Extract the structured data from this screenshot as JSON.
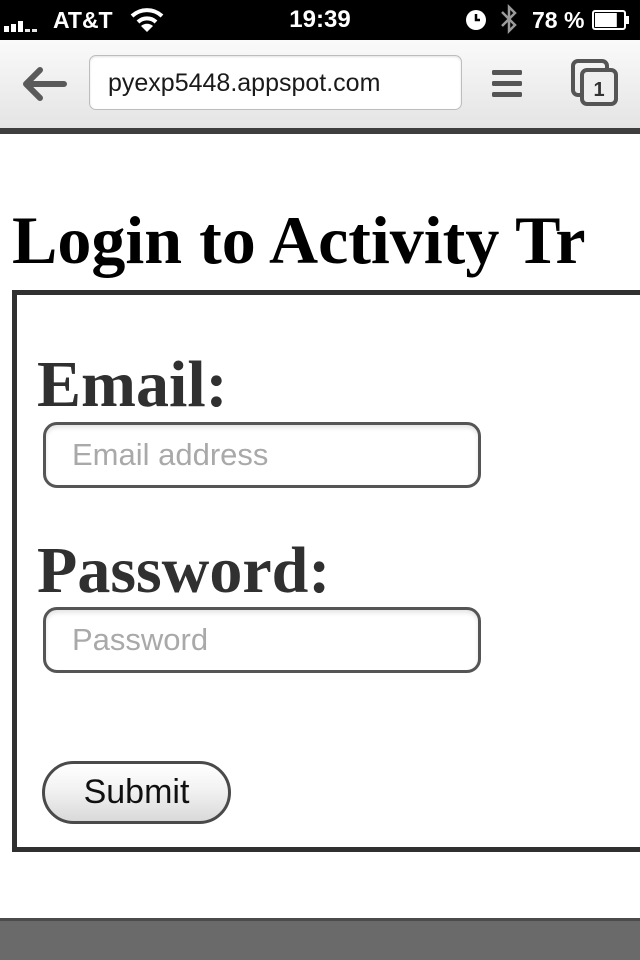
{
  "status_bar": {
    "carrier": "AT&T",
    "time": "19:39",
    "battery_percent": "78 %",
    "battery_level": 0.78,
    "icons": [
      "signal-bars-icon",
      "wifi-icon",
      "lock-rotation-icon",
      "bluetooth-icon",
      "battery-icon"
    ]
  },
  "browser": {
    "url": "pyexp5448.appspot.com",
    "tab_count": "1",
    "icons": [
      "back-arrow-icon",
      "menu-icon",
      "tabs-icon"
    ]
  },
  "page": {
    "title": "Login to Activity Tr",
    "form": {
      "email_label": "Email:",
      "email_placeholder": "Email address",
      "email_value": "",
      "password_label": "Password:",
      "password_placeholder": "Password",
      "password_value": "",
      "submit_label": "Submit"
    }
  },
  "colors": {
    "status_bar_bg": "#000000",
    "label_text": "#303030",
    "placeholder_text": "#a9a9a9",
    "bottom_bar": "#6a6a6a"
  }
}
